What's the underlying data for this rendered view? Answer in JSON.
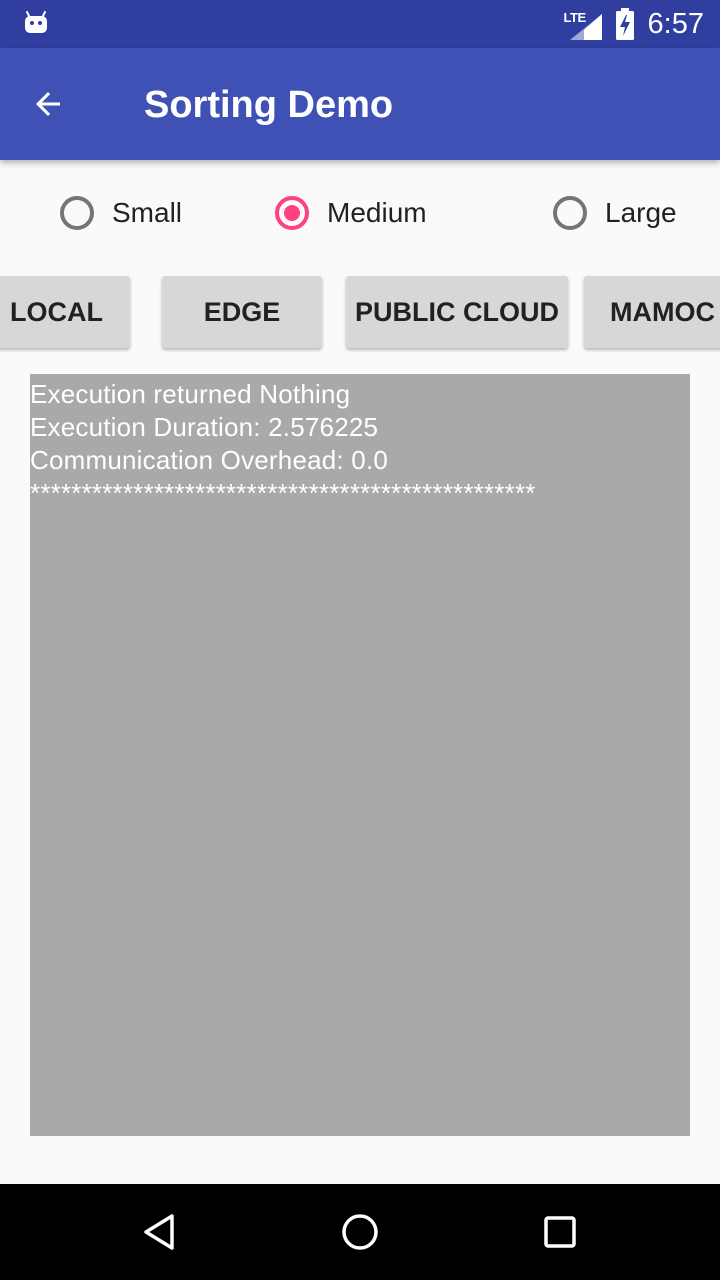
{
  "status_bar": {
    "network_label": "LTE",
    "time": "6:57",
    "notification_icon": "android-robot-icon",
    "signal_icon": "cell-signal-icon",
    "battery_icon": "battery-charging-icon"
  },
  "app_bar": {
    "title": "Sorting Demo",
    "back_icon": "arrow-left-icon",
    "background_color": "#3f51b5",
    "status_color": "#303f9f"
  },
  "size_options": {
    "items": [
      {
        "label": "Small",
        "checked": false
      },
      {
        "label": "Medium",
        "checked": true
      },
      {
        "label": "Large",
        "checked": false
      }
    ],
    "accent_color": "#ff4081"
  },
  "actions": {
    "local": "LOCAL",
    "edge": "EDGE",
    "public_cloud": "PUBLIC CLOUD",
    "mamoc": "MAMOC"
  },
  "output": {
    "lines": [
      "Execution returned Nothing",
      "Execution Duration: 2.576225",
      "Communication Overhead: 0.0",
      "*************************************************"
    ],
    "background_color": "#a9a9a9"
  },
  "nav_bar": {
    "back_icon": "triangle-back-icon",
    "home_icon": "circle-home-icon",
    "recents_icon": "square-recents-icon"
  }
}
